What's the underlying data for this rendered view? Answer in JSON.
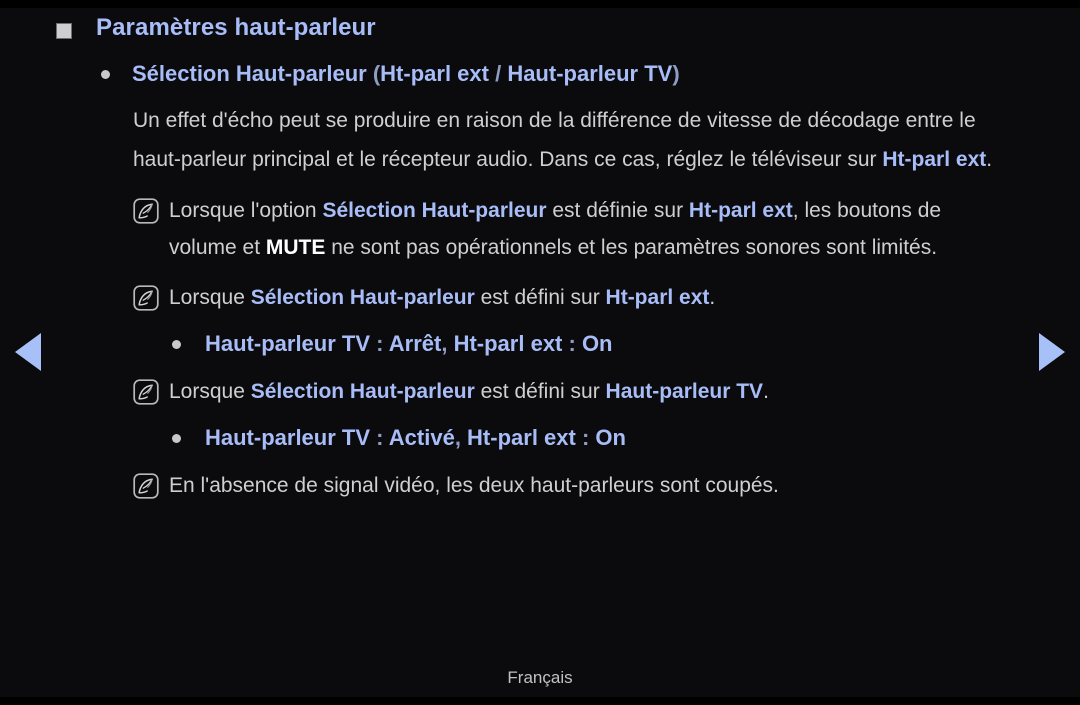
{
  "page": {
    "background_color": "#0b0b0e",
    "accent_color": "#a8bdf8",
    "body_text_color": "#cfcfcf",
    "language_footer": "Français"
  },
  "navigation": {
    "prev_label": "◀",
    "next_label": "▶",
    "prev_name": "previous-page-arrow",
    "next_name": "next-page-arrow"
  },
  "heading": {
    "title": "Paramètres haut-parleur",
    "bullet_icon": "square-bullet-icon"
  },
  "section_bullet": {
    "term": "Sélection Haut-parleur",
    "open_paren": " (",
    "option_a": "Ht-parl ext",
    "separator": " / ",
    "option_b": "Haut-parleur TV",
    "close_paren": ")"
  },
  "paragraph": {
    "part1": "Un effet d'écho peut se produire en raison de la différence de vitesse de décodage entre le haut-parleur principal et le récepteur audio. Dans ce cas, réglez le téléviseur sur ",
    "highlight": "Ht-parl ext",
    "part2": "."
  },
  "notes": [
    {
      "icon": "note-feather-icon",
      "segments": [
        {
          "text": "Lorsque l'option ",
          "style": "gray"
        },
        {
          "text": "Sélection Haut-parleur",
          "style": "blue"
        },
        {
          "text": " est définie sur ",
          "style": "gray"
        },
        {
          "text": "Ht-parl ext",
          "style": "blue"
        },
        {
          "text": ", les boutons de volume et ",
          "style": "gray"
        },
        {
          "text": "MUTE",
          "style": "white"
        },
        {
          "text": " ne sont pas opérationnels et les paramètres sonores sont limités.",
          "style": "gray"
        }
      ]
    },
    {
      "icon": "note-feather-icon",
      "segments": [
        {
          "text": "Lorsque ",
          "style": "gray"
        },
        {
          "text": "Sélection Haut-parleur",
          "style": "blue"
        },
        {
          "text": " est défini sur ",
          "style": "gray"
        },
        {
          "text": "Ht-parl ext",
          "style": "blue"
        },
        {
          "text": ".",
          "style": "gray"
        }
      ]
    },
    {
      "icon": "note-feather-icon",
      "segments": [
        {
          "text": "Lorsque ",
          "style": "gray"
        },
        {
          "text": "Sélection Haut-parleur",
          "style": "blue"
        },
        {
          "text": " est défini sur ",
          "style": "gray"
        },
        {
          "text": "Haut-parleur TV",
          "style": "blue"
        },
        {
          "text": ".",
          "style": "gray"
        }
      ]
    },
    {
      "icon": "note-feather-icon",
      "segments": [
        {
          "text": "En l'absence de signal vidéo, les deux haut-parleurs sont coupés.",
          "style": "gray"
        }
      ]
    }
  ],
  "sub_bullets": [
    {
      "bullet_icon": "dot-bullet-icon",
      "segments": [
        {
          "text": "Haut-parleur TV",
          "style": "blue"
        },
        {
          "text": " : ",
          "style": "blue-dim"
        },
        {
          "text": "Arrêt",
          "style": "blue"
        },
        {
          "text": ", ",
          "style": "blue-dim"
        },
        {
          "text": "Ht-parl ext",
          "style": "blue"
        },
        {
          "text": " : ",
          "style": "blue-dim"
        },
        {
          "text": "On",
          "style": "blue"
        }
      ]
    },
    {
      "bullet_icon": "dot-bullet-icon",
      "segments": [
        {
          "text": "Haut-parleur TV",
          "style": "blue"
        },
        {
          "text": " : ",
          "style": "blue-dim"
        },
        {
          "text": "Activé",
          "style": "blue"
        },
        {
          "text": ", ",
          "style": "blue-dim"
        },
        {
          "text": "Ht-parl ext",
          "style": "blue"
        },
        {
          "text": " : ",
          "style": "blue-dim"
        },
        {
          "text": "On",
          "style": "blue"
        }
      ]
    }
  ]
}
